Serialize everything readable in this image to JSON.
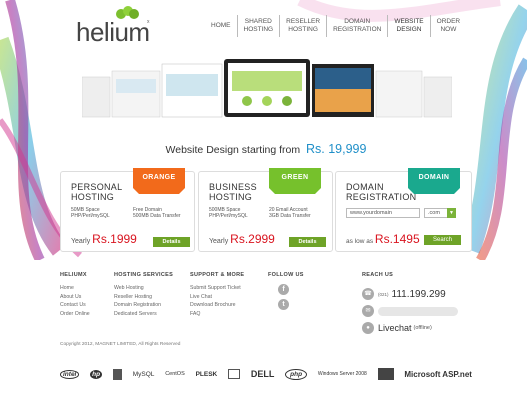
{
  "brand": {
    "name": "helium",
    "tm": "x"
  },
  "nav": [
    {
      "label": "HOME"
    },
    {
      "label": "SHARED\nHOSTING"
    },
    {
      "label": "RESELLER\nHOSTING"
    },
    {
      "label": "DOMAIN\nREGISTRATION"
    },
    {
      "label": "WEBSITE\nDESIGN"
    },
    {
      "label": "ORDER\nNOW"
    }
  ],
  "hero": {
    "text": "Website Design starting from",
    "price": "Rs. 19,999"
  },
  "cards": {
    "personal": {
      "title1": "PERSONAL",
      "title2": "HOSTING",
      "ribbon": "ORANGE",
      "spec_left": [
        "50MB Space",
        "PHP/Perl/mySQL"
      ],
      "spec_right": [
        "Free Domain",
        "500MB Data Transfer"
      ],
      "price_label": "Yearly",
      "price": "Rs.1999",
      "button": "Details"
    },
    "business": {
      "title1": "BUSINESS",
      "title2": "HOSTING",
      "ribbon": "GREEN",
      "spec_left": [
        "500MB Space",
        "PHP/Perl/mySQL"
      ],
      "spec_right": [
        "20 Email Account",
        "3GB Data Transfer"
      ],
      "price_label": "Yearly",
      "price": "Rs.2999",
      "button": "Details"
    },
    "domain": {
      "title1": "DOMAIN",
      "title2": "REGISTRATION",
      "ribbon": "DOMAIN",
      "input_value": "www.yourdomain",
      "ext": ".com",
      "price_label": "as low as",
      "price": "Rs.1495",
      "button": "Search"
    }
  },
  "footer": {
    "heliumx": {
      "head": "HELIUMX",
      "links": [
        "Home",
        "About Us",
        "Contact Us",
        "Order Online"
      ]
    },
    "hosting": {
      "head": "HOSTING SERVICES",
      "links": [
        "Web Hosting",
        "Reseller Hosting",
        "Domain Registration",
        "Dedicated Servers"
      ]
    },
    "support": {
      "head": "SUPPORT & MORE",
      "links": [
        "Submit Support Ticket",
        "Live Chat",
        "Download Brochure",
        "FAQ"
      ]
    },
    "follow": {
      "head": "FOLLOW US",
      "facebook": "f",
      "twitter": "t"
    },
    "reach": {
      "head": "REACH US",
      "phone_prefix": "(021)",
      "phone": "111.199.299",
      "livechat": "Livechat",
      "livechat_status": "(offline)"
    },
    "copyright": "Copyright 2012, MAGNET LIMITED, All Rights Reserved",
    "partners": [
      "intel",
      "hp",
      "",
      "MySQL",
      "CentOS",
      "PLESK",
      "",
      "DELL",
      "php",
      "Windows Server 2008",
      "",
      "Microsoft ASP.net"
    ]
  },
  "colors": {
    "orange": "#f26a1b",
    "green": "#76c12c",
    "teal": "#1aa98e",
    "red": "#d9141f",
    "blue": "#1f8fc8",
    "button_green": "#6ea327"
  }
}
